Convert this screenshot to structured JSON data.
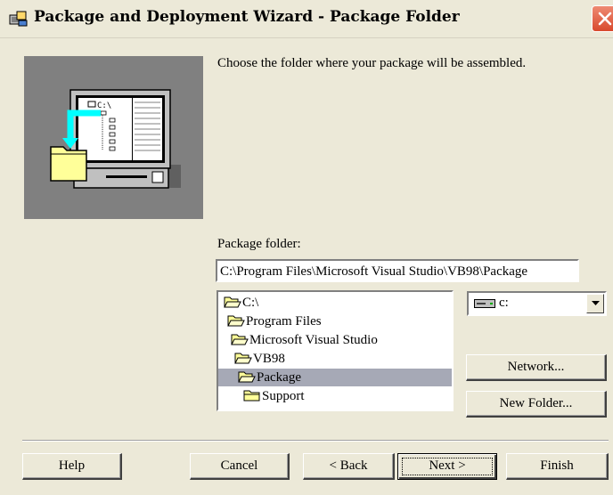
{
  "window": {
    "title": "Package and Deployment Wizard - Package Folder",
    "icon": "setup-wizard-icon",
    "close_icon": "close-icon"
  },
  "illustration": {
    "icon": "computer-folder-illustration",
    "screen_label": "C:\\"
  },
  "prompt": "Choose the folder where your package will be assembled.",
  "package_folder": {
    "label": "Package folder:",
    "value": "C:\\Program Files\\Microsoft Visual Studio\\VB98\\Package"
  },
  "folder_tree": {
    "items": [
      {
        "label": "C:\\",
        "icon": "open-folder-icon",
        "selected": false
      },
      {
        "label": "Program Files",
        "icon": "open-folder-icon",
        "selected": false
      },
      {
        "label": "Microsoft Visual Studio",
        "icon": "open-folder-icon",
        "selected": false
      },
      {
        "label": "VB98",
        "icon": "open-folder-icon",
        "selected": false
      },
      {
        "label": "Package",
        "icon": "open-folder-icon",
        "selected": true
      },
      {
        "label": "Support",
        "icon": "folder-icon",
        "selected": false
      }
    ]
  },
  "drive_select": {
    "value": "c:",
    "icon": "drive-icon"
  },
  "buttons": {
    "network": "Network...",
    "new_folder": "New Folder...",
    "help": "Help",
    "cancel": "Cancel",
    "back": "< Back",
    "next": "Next >",
    "finish": "Finish"
  },
  "colors": {
    "dialog_bg": "#ece9d8",
    "selection": "#a6a9b6",
    "illustration_bg": "#808080",
    "folder_yellow": "#ffff99",
    "arrow_cyan": "#00ffff"
  }
}
